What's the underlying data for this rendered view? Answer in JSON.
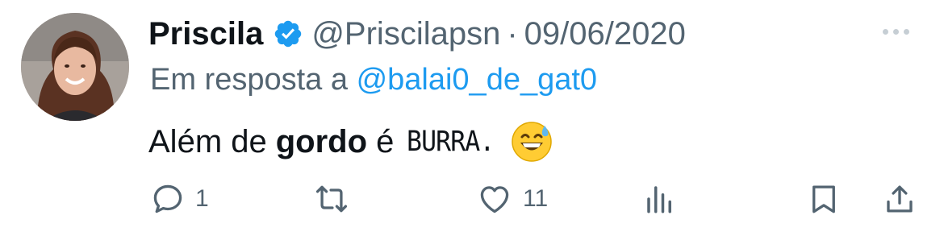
{
  "tweet": {
    "author_name": "Priscila",
    "handle": "@Priscilapsn",
    "separator": "·",
    "date": "09/06/2020",
    "reply_prefix": "Em resposta a",
    "reply_mention": "@balai0_de_gat0",
    "text_part1": "Além de",
    "text_bold": "gordo",
    "text_part2": "é",
    "text_caps": "BURRA.",
    "emoji": "grinning-face-with-sweat"
  },
  "actions": {
    "reply_count": "1",
    "like_count": "11"
  },
  "colors": {
    "text": "#0f1419",
    "secondary": "#536471",
    "link": "#1d9bf0",
    "verified_badge": "#1d9bf0"
  }
}
